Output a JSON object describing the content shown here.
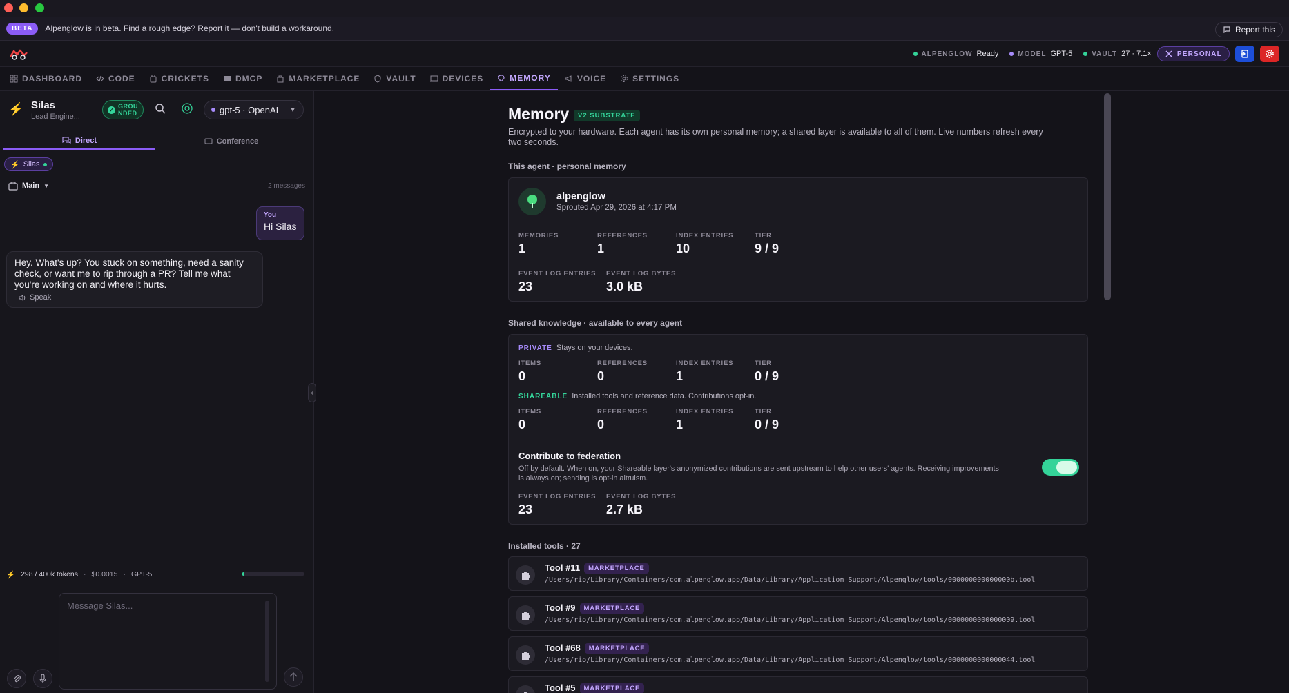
{
  "banner": {
    "badge": "BETA",
    "message": "Alpenglow is in beta. Find a rough edge? Report it — don't build a workaround.",
    "report_label": "Report this"
  },
  "status": {
    "alpenglow_key": "ALPENGLOW",
    "alpenglow_val": "Ready",
    "model_key": "MODEL",
    "model_val": "GPT-5",
    "vault_key": "VAULT",
    "vault_val": "27 · 7.1×",
    "personal_label": "PERSONAL"
  },
  "nav": {
    "items": [
      {
        "label": "DASHBOARD",
        "icon": "grid-icon"
      },
      {
        "label": "CODE",
        "icon": "code-icon"
      },
      {
        "label": "CRICKETS",
        "icon": "cricket-icon"
      },
      {
        "label": "DMCP",
        "icon": "server-icon"
      },
      {
        "label": "MARKETPLACE",
        "icon": "bag-icon"
      },
      {
        "label": "VAULT",
        "icon": "shield-icon"
      },
      {
        "label": "DEVICES",
        "icon": "devices-icon"
      },
      {
        "label": "MEMORY",
        "icon": "brain-icon"
      },
      {
        "label": "VOICE",
        "icon": "megaphone-icon"
      },
      {
        "label": "SETTINGS",
        "icon": "gear-icon"
      }
    ],
    "active": "MEMORY"
  },
  "agent": {
    "name": "Silas",
    "role": "Lead Engine...",
    "grounded": "GROU NDED",
    "model_pill": "gpt-5 · OpenAI"
  },
  "chat": {
    "tab_direct": "Direct",
    "tab_conference": "Conference",
    "chip": "Silas",
    "thread": "Main",
    "count": "2 messages",
    "you_label": "You",
    "you_text": "Hi Silas",
    "ai_text": "Hey. What's up? You stuck on something, need a sanity check, or want me to rip through a PR? Tell me what you're working on and where it hurts.",
    "speak": "Speak",
    "tokens": "298 / 400k tokens",
    "cost": "$0.0015",
    "model": "GPT-5",
    "token_usage_fraction": 0.00075,
    "placeholder": "Message Silas..."
  },
  "memory": {
    "title": "Memory",
    "badge": "V2 SUBSTRATE",
    "desc": "Encrypted to your hardware. Each agent has its own personal memory; a shared layer is available to all of them. Live numbers refresh every two seconds.",
    "this_agent_label": "This agent · personal memory",
    "agent_name": "alpenglow",
    "sprouted": "Sprouted Apr 29, 2026 at 4:17 PM",
    "personal_stats": [
      {
        "k": "MEMORIES",
        "v": "1"
      },
      {
        "k": "REFERENCES",
        "v": "1"
      },
      {
        "k": "INDEX ENTRIES",
        "v": "10"
      },
      {
        "k": "TIER",
        "v": "9 / 9"
      }
    ],
    "personal_log": [
      {
        "k": "EVENT LOG ENTRIES",
        "v": "23"
      },
      {
        "k": "EVENT LOG BYTES",
        "v": "3.0 kB"
      }
    ],
    "shared_label": "Shared knowledge · available to every agent",
    "private_tag": "PRIVATE",
    "private_desc": "Stays on your devices.",
    "private_stats": [
      {
        "k": "ITEMS",
        "v": "0"
      },
      {
        "k": "REFERENCES",
        "v": "0"
      },
      {
        "k": "INDEX ENTRIES",
        "v": "1"
      },
      {
        "k": "TIER",
        "v": "0 / 9"
      }
    ],
    "share_tag": "SHAREABLE",
    "share_desc": "Installed tools and reference data. Contributions opt-in.",
    "share_stats": [
      {
        "k": "ITEMS",
        "v": "0"
      },
      {
        "k": "REFERENCES",
        "v": "0"
      },
      {
        "k": "INDEX ENTRIES",
        "v": "1"
      },
      {
        "k": "TIER",
        "v": "0 / 9"
      }
    ],
    "fed_title": "Contribute to federation",
    "fed_desc": "Off by default. When on, your Shareable layer's anonymized contributions are sent upstream to help other users' agents. Receiving improvements is always on; sending is opt-in altruism.",
    "shared_log": [
      {
        "k": "EVENT LOG ENTRIES",
        "v": "23"
      },
      {
        "k": "EVENT LOG BYTES",
        "v": "2.7 kB"
      }
    ],
    "tools_label": "Installed tools · 27",
    "tools": [
      {
        "name": "Tool #11",
        "badge": "MARKETPLACE",
        "path": "/Users/rio/Library/Containers/com.alpenglow.app/Data/Library/Application Support/Alpenglow/tools/000000000000000b.tool"
      },
      {
        "name": "Tool #9",
        "badge": "MARKETPLACE",
        "path": "/Users/rio/Library/Containers/com.alpenglow.app/Data/Library/Application Support/Alpenglow/tools/0000000000000009.tool"
      },
      {
        "name": "Tool #68",
        "badge": "MARKETPLACE",
        "path": "/Users/rio/Library/Containers/com.alpenglow.app/Data/Library/Application Support/Alpenglow/tools/0000000000000044.tool"
      },
      {
        "name": "Tool #5",
        "badge": "MARKETPLACE",
        "path": ""
      }
    ]
  }
}
